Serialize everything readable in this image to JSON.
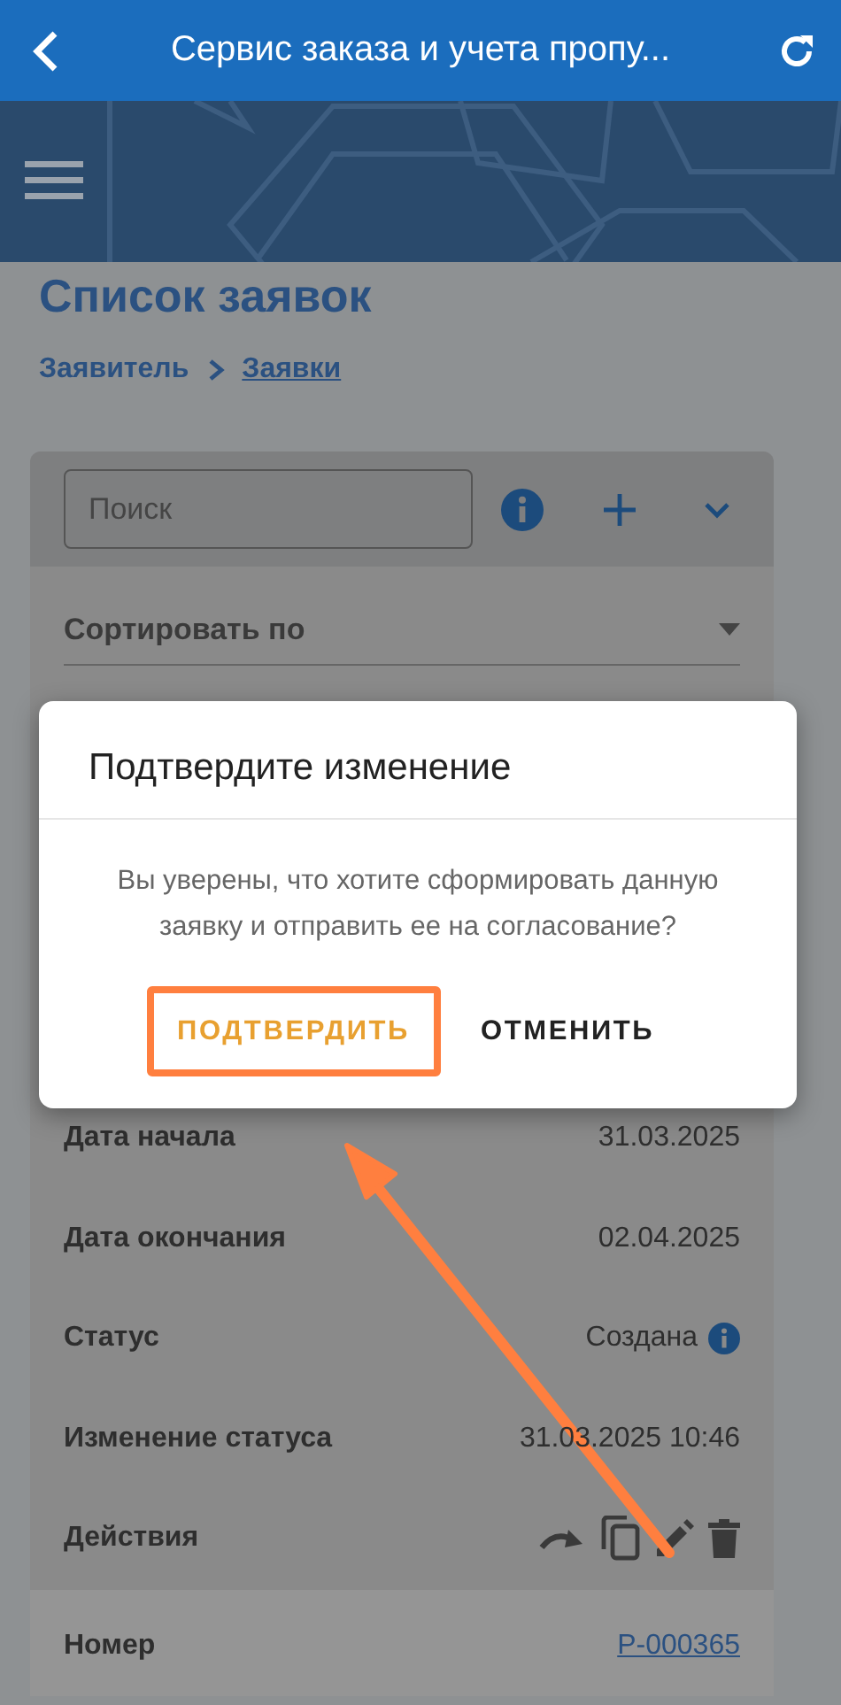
{
  "app_bar": {
    "title": "Сервис заказа и учета пропу..."
  },
  "page": {
    "title": "Список заявок",
    "breadcrumbs": [
      {
        "label": "Заявитель",
        "current": false
      },
      {
        "label": "Заявки",
        "current": true
      }
    ]
  },
  "search": {
    "placeholder": "Поиск"
  },
  "sort": {
    "label": "Сортировать по"
  },
  "details": [
    {
      "kind": "text",
      "label": "Дата начала",
      "value": "31.03.2025"
    },
    {
      "kind": "text",
      "label": "Дата окончания",
      "value": "02.04.2025"
    },
    {
      "kind": "status",
      "label": "Статус",
      "value": "Создана"
    },
    {
      "kind": "text",
      "label": "Изменение статуса",
      "value": "31.03.2025 10:46"
    },
    {
      "kind": "actions",
      "label": "Действия"
    }
  ],
  "next_request": {
    "label": "Номер",
    "value": "Р-000365"
  },
  "dialog": {
    "title": "Подтвердите изменение",
    "message": "Вы уверены, что хотите сформировать данную заявку и отправить ее на согласование?",
    "buttons": [
      {
        "kind": "confirm",
        "label": "ПОДТВЕРДИТЬ",
        "highlighted": true
      },
      {
        "kind": "cancel",
        "label": "ОТМЕНИТЬ",
        "highlighted": false
      }
    ]
  }
}
